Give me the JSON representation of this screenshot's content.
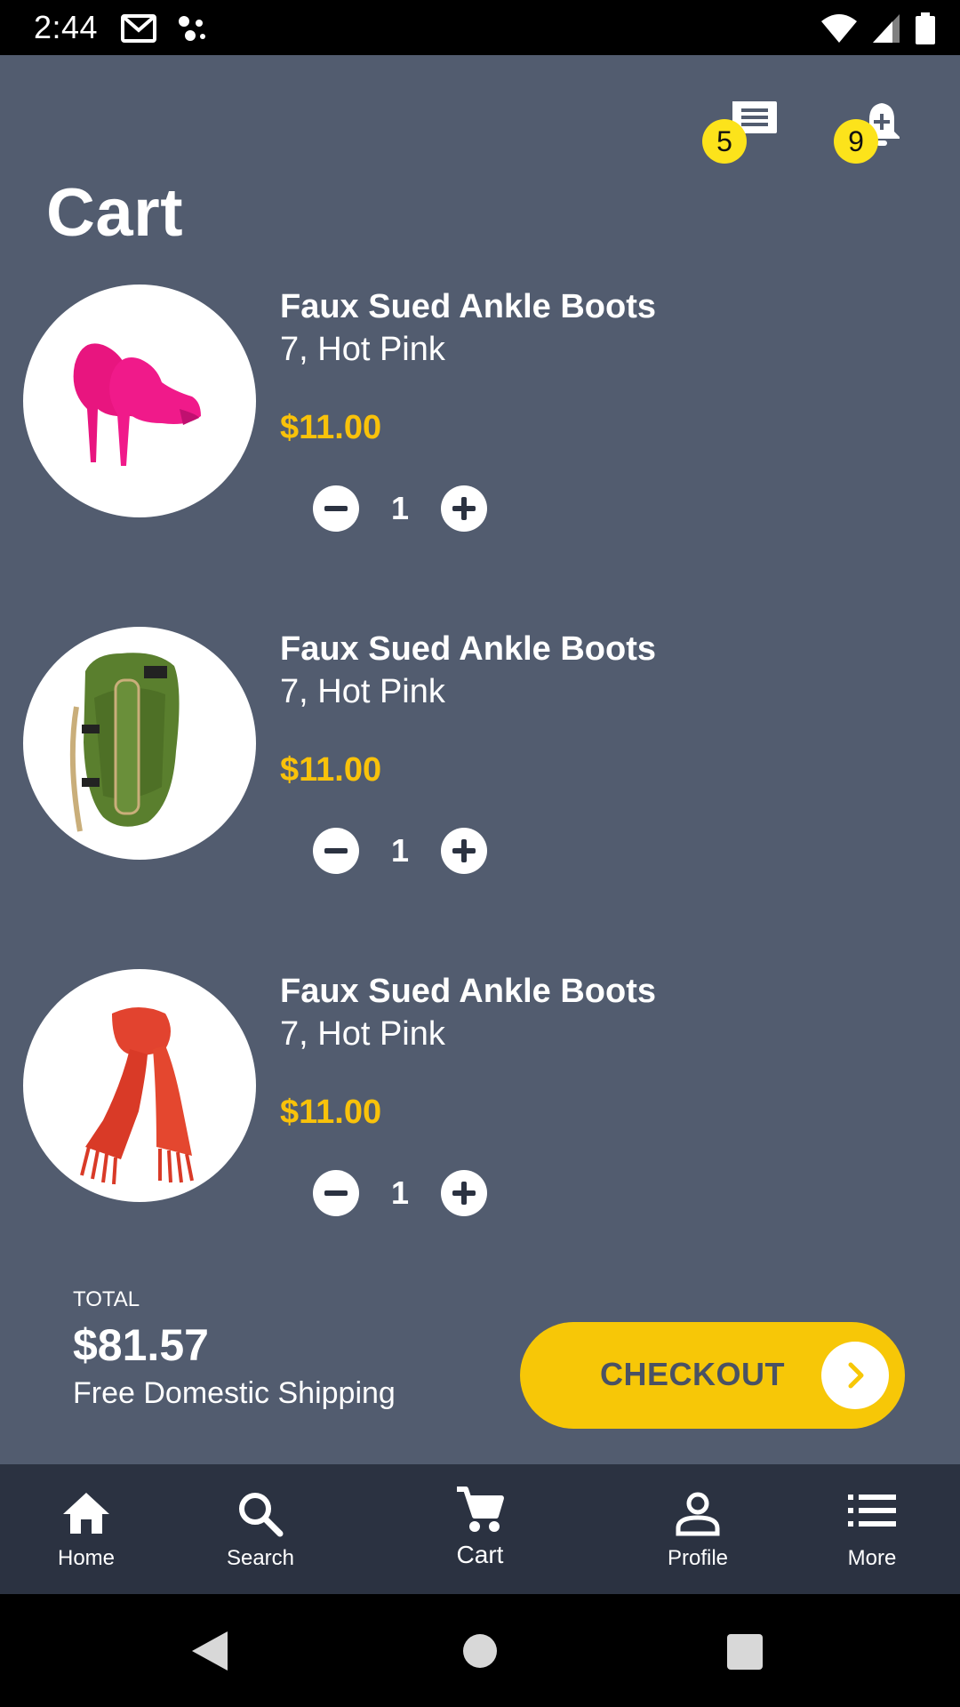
{
  "status_bar": {
    "time": "2:44"
  },
  "header": {
    "messages_badge": "5",
    "notifications_badge": "9",
    "title": "Cart"
  },
  "cart_items": [
    {
      "name": "Faux Sued Ankle Boots",
      "variant": "7, Hot Pink",
      "price": "$11.00",
      "quantity": "1",
      "image": "pink-ankle-boots"
    },
    {
      "name": "Faux Sued Ankle Boots",
      "variant": "7, Hot Pink",
      "price": "$11.00",
      "quantity": "1",
      "image": "green-backpack"
    },
    {
      "name": "Faux Sued Ankle Boots",
      "variant": "7, Hot Pink",
      "price": "$11.00",
      "quantity": "1",
      "image": "red-scarf"
    }
  ],
  "summary": {
    "total_label": "TOTAL",
    "total_amount": "$81.57",
    "shipping": "Free Domestic Shipping",
    "checkout_label": "CHECKOUT"
  },
  "bottom_nav": [
    {
      "label": "Home",
      "icon": "home-icon"
    },
    {
      "label": "Search",
      "icon": "search-icon"
    },
    {
      "label": "Cart",
      "icon": "cart-icon"
    },
    {
      "label": "Profile",
      "icon": "profile-icon"
    },
    {
      "label": "More",
      "icon": "list-icon"
    }
  ],
  "colors": {
    "background": "#525c6f",
    "accent": "#f7c707",
    "badge": "#fce31b",
    "nav_background": "#2b3241"
  }
}
